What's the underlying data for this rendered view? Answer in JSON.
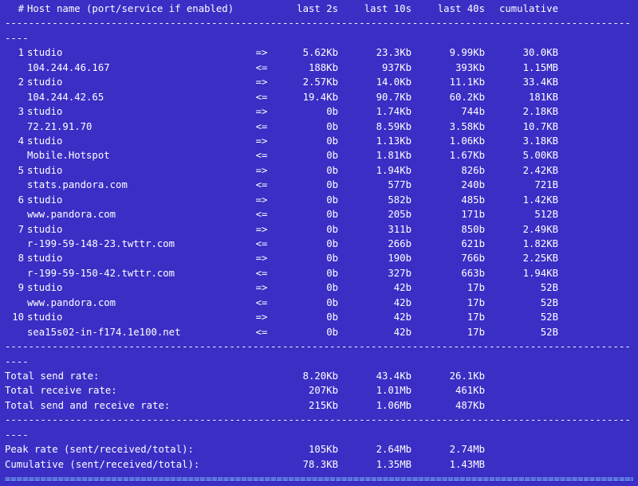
{
  "header": {
    "num_col": "#",
    "host_col": "Host name (port/service if enabled)",
    "last2": "last 2s",
    "last10": "last 10s",
    "last40": "last 40s",
    "cum": "cumulative"
  },
  "arrows": {
    "out": "=>",
    "in": "<="
  },
  "dashes": "--------------------------------------------------------------------------------------------------------------",
  "eqline": "==============================================================================================================",
  "rows": [
    {
      "n": "1",
      "local": "studio",
      "remote": "104.244.46.167",
      "out": {
        "l2": "5.62Kb",
        "l10": "23.3Kb",
        "l40": "9.99Kb",
        "cum": "30.0KB"
      },
      "in": {
        "l2": "188Kb",
        "l10": "937Kb",
        "l40": "393Kb",
        "cum": "1.15MB"
      }
    },
    {
      "n": "2",
      "local": "studio",
      "remote": "104.244.42.65",
      "out": {
        "l2": "2.57Kb",
        "l10": "14.0Kb",
        "l40": "11.1Kb",
        "cum": "33.4KB"
      },
      "in": {
        "l2": "19.4Kb",
        "l10": "90.7Kb",
        "l40": "60.2Kb",
        "cum": "181KB"
      }
    },
    {
      "n": "3",
      "local": "studio",
      "remote": "72.21.91.70",
      "out": {
        "l2": "0b",
        "l10": "1.74Kb",
        "l40": "744b",
        "cum": "2.18KB"
      },
      "in": {
        "l2": "0b",
        "l10": "8.59Kb",
        "l40": "3.58Kb",
        "cum": "10.7KB"
      }
    },
    {
      "n": "4",
      "local": "studio",
      "remote": "Mobile.Hotspot",
      "out": {
        "l2": "0b",
        "l10": "1.13Kb",
        "l40": "1.06Kb",
        "cum": "3.18KB"
      },
      "in": {
        "l2": "0b",
        "l10": "1.81Kb",
        "l40": "1.67Kb",
        "cum": "5.00KB"
      }
    },
    {
      "n": "5",
      "local": "studio",
      "remote": "stats.pandora.com",
      "out": {
        "l2": "0b",
        "l10": "1.94Kb",
        "l40": "826b",
        "cum": "2.42KB"
      },
      "in": {
        "l2": "0b",
        "l10": "577b",
        "l40": "240b",
        "cum": "721B"
      }
    },
    {
      "n": "6",
      "local": "studio",
      "remote": "www.pandora.com",
      "out": {
        "l2": "0b",
        "l10": "582b",
        "l40": "485b",
        "cum": "1.42KB"
      },
      "in": {
        "l2": "0b",
        "l10": "205b",
        "l40": "171b",
        "cum": "512B"
      }
    },
    {
      "n": "7",
      "local": "studio",
      "remote": "r-199-59-148-23.twttr.com",
      "out": {
        "l2": "0b",
        "l10": "311b",
        "l40": "850b",
        "cum": "2.49KB"
      },
      "in": {
        "l2": "0b",
        "l10": "266b",
        "l40": "621b",
        "cum": "1.82KB"
      }
    },
    {
      "n": "8",
      "local": "studio",
      "remote": "r-199-59-150-42.twttr.com",
      "out": {
        "l2": "0b",
        "l10": "190b",
        "l40": "766b",
        "cum": "2.25KB"
      },
      "in": {
        "l2": "0b",
        "l10": "327b",
        "l40": "663b",
        "cum": "1.94KB"
      }
    },
    {
      "n": "9",
      "local": "studio",
      "remote": "www.pandora.com",
      "out": {
        "l2": "0b",
        "l10": "42b",
        "l40": "17b",
        "cum": "52B"
      },
      "in": {
        "l2": "0b",
        "l10": "42b",
        "l40": "17b",
        "cum": "52B"
      }
    },
    {
      "n": "10",
      "local": "studio",
      "remote": "sea15s02-in-f174.1e100.net",
      "out": {
        "l2": "0b",
        "l10": "42b",
        "l40": "17b",
        "cum": "52B"
      },
      "in": {
        "l2": "0b",
        "l10": "42b",
        "l40": "17b",
        "cum": "52B"
      }
    }
  ],
  "totals": [
    {
      "label": "Total send rate:",
      "l2": "8.20Kb",
      "l10": "43.4Kb",
      "l40": "26.1Kb",
      "cum": ""
    },
    {
      "label": "Total receive rate:",
      "l2": "207Kb",
      "l10": "1.01Mb",
      "l40": "461Kb",
      "cum": ""
    },
    {
      "label": "Total send and receive rate:",
      "l2": "215Kb",
      "l10": "1.06Mb",
      "l40": "487Kb",
      "cum": ""
    }
  ],
  "peaks": [
    {
      "label": "Peak rate (sent/received/total):",
      "l2": "105Kb",
      "l10": "2.64Mb",
      "l40": "2.74Mb",
      "cum": ""
    },
    {
      "label": "Cumulative (sent/received/total):",
      "l2": "78.3KB",
      "l10": "1.35MB",
      "l40": "1.43MB",
      "cum": ""
    }
  ]
}
